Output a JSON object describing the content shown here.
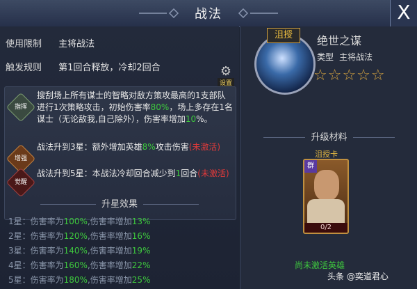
{
  "header": {
    "title": "战法",
    "close": "X"
  },
  "left": {
    "use_limit": {
      "label": "使用限制",
      "value": "主将战法"
    },
    "trigger": {
      "label": "触发规则",
      "value": "第1回合释放，冷却2回合"
    },
    "settings_label": "设置",
    "badges": [
      "指挥",
      "增强",
      "觉醒"
    ],
    "skill_main": {
      "p1": "搜刮场上所有谋士的智略对敌方策攻最高的1支部队进行1次策略攻击，初始伤害率",
      "v1": "80%",
      "p2": "，场上多存在1名谋士（无论敌我,自己除外），伤害率增加",
      "v2": "10",
      "p3": "%。"
    },
    "skill_up3": {
      "t1": "战法升到3星：额外增加英雄",
      "v": "8%",
      "t2": "攻击伤害",
      "inactive": "(未激活)"
    },
    "skill_up5": {
      "t1": "战法升到5星：本战法冷却回合减少到",
      "v": "1",
      "t2": "回合",
      "inactive": "(未激活)"
    },
    "star_effect_title": "升星效果",
    "star_rows": [
      {
        "star": "1星：",
        "a": "伤害率为",
        "b": "100%",
        "c": ",伤害率增加",
        "d": "13%"
      },
      {
        "star": "2星：",
        "a": "伤害率为",
        "b": "120%",
        "c": ",伤害率增加",
        "d": "16%"
      },
      {
        "star": "3星：",
        "a": "伤害率为",
        "b": "140%",
        "c": ",伤害率增加",
        "d": "19%"
      },
      {
        "star": "4星：",
        "a": "伤害率为",
        "b": "160%",
        "c": ",伤害率增加",
        "d": "22%"
      },
      {
        "star": "5星：",
        "a": "伤害率为",
        "b": "180%",
        "c": ",伤害率增加",
        "d": "25%"
      }
    ]
  },
  "right": {
    "hero_tag": "沮授",
    "skill_name": "绝世之谋",
    "type_label": "类型",
    "type_value": "主将战法",
    "stars": "☆☆☆☆☆",
    "upgrade_title": "升级材料",
    "card_label": "沮授卡",
    "card_faction": "群",
    "card_progress": "0/2",
    "card_progress_value": 0.0,
    "status": "尚未激活英雄",
    "watermark": "头条 @奕道君心"
  },
  "colors": {
    "accent_green": "#3ec93e",
    "accent_red": "#e03a3a",
    "accent_gold": "#d0a040"
  }
}
